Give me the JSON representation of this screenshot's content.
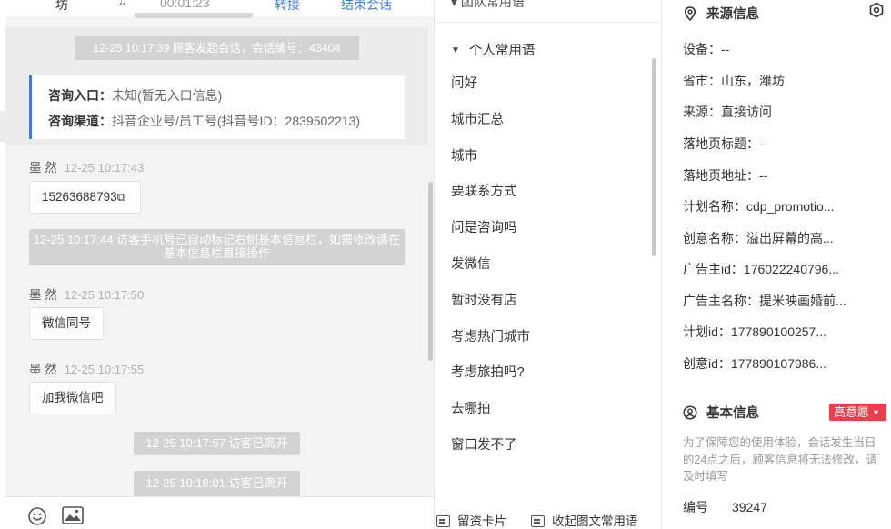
{
  "chat": {
    "header": {
      "name": "坊",
      "timer": "00:01:23",
      "transfer_label": "转接",
      "end_label": "结束会话"
    },
    "session_start": "12-25 10:17:39 顾客发起会话，会话编号：43404",
    "consult_card": {
      "entry_label": "咨询入口：",
      "entry_value": "未知(暂无入口信息)",
      "channel_label": "咨询渠道：",
      "channel_value": "抖音企业号/员工号(抖音号ID：2839502213)"
    },
    "messages": [
      {
        "sender": "墨 然",
        "time": "12-25 10:17:43",
        "text": "15263688793"
      },
      {
        "sender": "墨 然",
        "time": "12-25 10:17:50",
        "text": "微信同号"
      },
      {
        "sender": "墨 然",
        "time": "12-25 10:17:55",
        "text": "加我微信吧"
      }
    ],
    "system_phone_notice": "12-25 10:17:44 访客手机号已自动标记右侧基本信息栏，如需修改请在基本信息栏直接操作",
    "system_left_1": "12-25 10:17:57 访客已离开",
    "system_left_2": "12-25 10:18:01 访客已离开"
  },
  "phrases": {
    "group_title": "个人常用语",
    "items": [
      "问好",
      "城市汇总",
      "城市",
      "要联系方式",
      "问是咨询吗",
      "发微信",
      "暂时没有店",
      "考虑热门城市",
      "考虑旅拍吗?",
      "去哪拍",
      "窗口发不了"
    ],
    "footer": {
      "card_label": "留资卡片",
      "collapse_label": "收起图文常用语"
    }
  },
  "info": {
    "source_title": "来源信息",
    "rows": [
      {
        "label": "设备：",
        "value": "--"
      },
      {
        "label": "省市：",
        "value": "山东，潍坊"
      },
      {
        "label": "来源：",
        "value": "直接访问"
      },
      {
        "label": "落地页标题：",
        "value": "--"
      },
      {
        "label": "落地页地址：",
        "value": "--"
      },
      {
        "label": "计划名称：",
        "value": "cdp_promotio..."
      },
      {
        "label": "创意名称：",
        "value": "溢出屏幕的高..."
      },
      {
        "label": "广告主id：",
        "value": "176022240796..."
      },
      {
        "label": "广告主名称：",
        "value": "提米映画婚前..."
      },
      {
        "label": "计划id：",
        "value": "177890100257..."
      },
      {
        "label": "创意id：",
        "value": "177890107986..."
      }
    ],
    "basic_title": "基本信息",
    "intent_badge": "高意愿",
    "notice": "为了保障您的使用体验，会话发生当日的24点之后，顾客信息将无法修改，请及时填写",
    "id_label": "编号",
    "id_value": "39247"
  },
  "colors": {
    "accent": "#3b7be8",
    "badge": "#ef3d4c",
    "system_msg": "#d3d3d3"
  }
}
